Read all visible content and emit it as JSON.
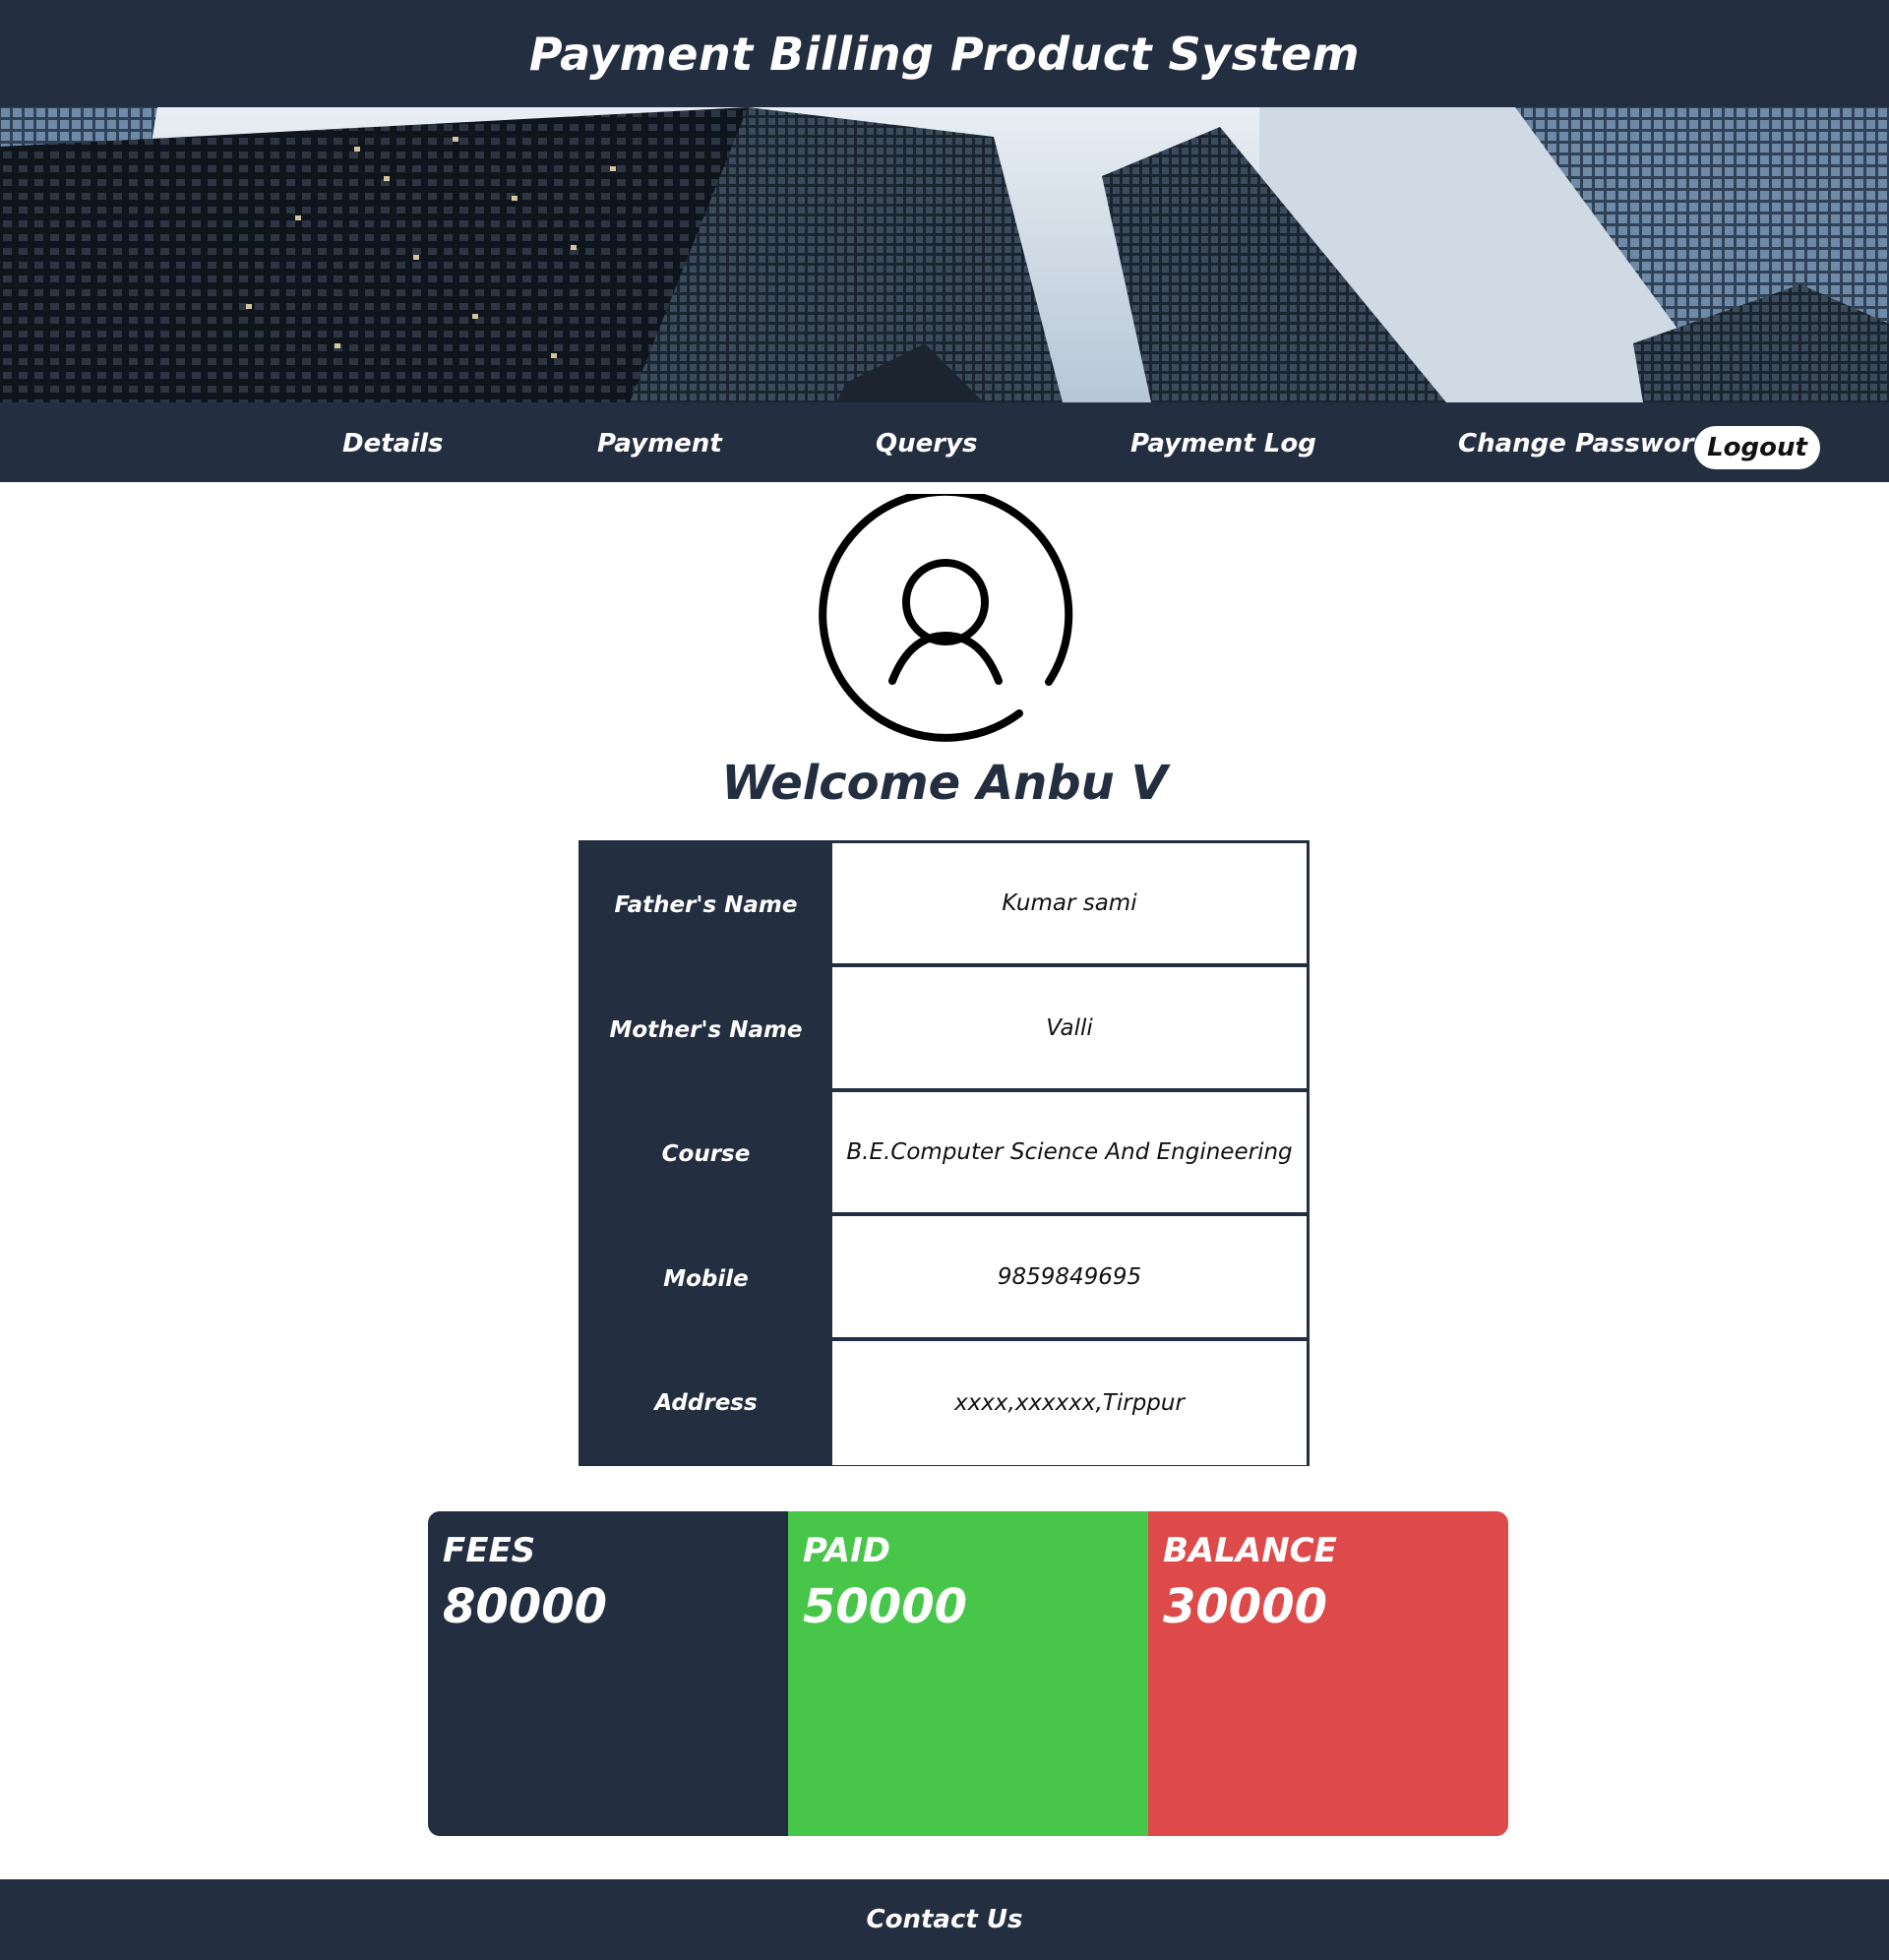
{
  "header": {
    "title": "Payment Billing Product System"
  },
  "nav": {
    "details": "Details",
    "payment": "Payment",
    "querys": "Querys",
    "payment_log": "Payment Log",
    "change_password": "Change Password",
    "logout": "Logout"
  },
  "profile": {
    "icon": "user-circle-icon",
    "welcome": "Welcome Anbu V"
  },
  "details": [
    {
      "label": "Father's Name",
      "value": "Kumar sami"
    },
    {
      "label": "Mother's Name",
      "value": "Valli"
    },
    {
      "label": "Course",
      "value": "B.E.Computer Science And Engineering"
    },
    {
      "label": "Mobile",
      "value": "9859849695"
    },
    {
      "label": "Address",
      "value": "xxxx,xxxxxx,Tirppur"
    }
  ],
  "summary": {
    "fees": {
      "label": "FEES",
      "value": "80000",
      "color": "#232f40"
    },
    "paid": {
      "label": "PAID",
      "value": "50000",
      "color": "#47c64a"
    },
    "balance": {
      "label": "BALANCE",
      "value": "30000",
      "color": "#de4a4a"
    }
  },
  "footer": {
    "contact": "Contact Us"
  },
  "colors": {
    "primary": "#232f40",
    "background": "#ffffff"
  }
}
